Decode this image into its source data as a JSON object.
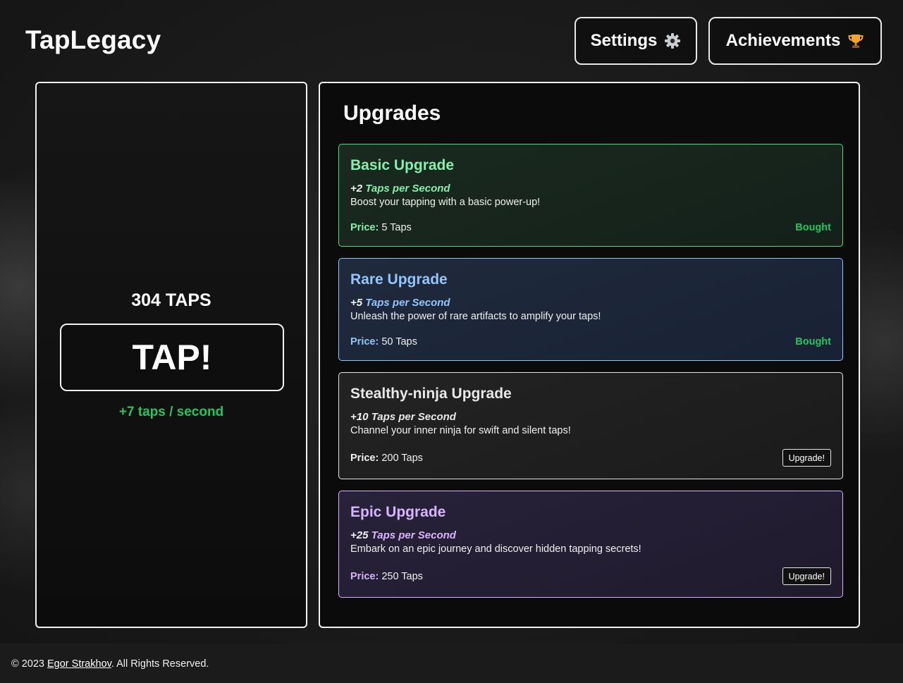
{
  "header": {
    "title": "TapLegacy",
    "settings_label": "Settings",
    "settings_icon": "gear-icon",
    "achievements_label": "Achievements",
    "achievements_icon": "trophy-icon"
  },
  "tapper": {
    "count_label": "304 TAPS",
    "button_label": "TAP!",
    "rate_label": "+7 taps / second"
  },
  "upgrades": {
    "heading": "Upgrades",
    "items": [
      {
        "title": "Basic Upgrade",
        "tps_amount": "+2",
        "tps_unit": "Taps per Second",
        "description": "Boost your tapping with a basic power-up!",
        "price_label": "Price:",
        "price_value": "5 Taps",
        "status": "Bought",
        "accent": "#86efac"
      },
      {
        "title": "Rare Upgrade",
        "tps_amount": "+5",
        "tps_unit": "Taps per Second",
        "description": "Unleash the power of rare artifacts to amplify your taps!",
        "price_label": "Price:",
        "price_value": "50 Taps",
        "status": "Bought",
        "accent": "#93c5fd"
      },
      {
        "title": "Stealthy-ninja Upgrade",
        "tps_amount": "+10",
        "tps_unit": "Taps per Second",
        "description": "Channel your inner ninja for swift and silent taps!",
        "price_label": "Price:",
        "price_value": "200 Taps",
        "status": "Upgrade!",
        "accent": "#e8e8e8"
      },
      {
        "title": "Epic Upgrade",
        "tps_amount": "+25",
        "tps_unit": "Taps per Second",
        "description": "Embark on an epic journey and discover hidden tapping secrets!",
        "price_label": "Price:",
        "price_value": "250 Taps",
        "status": "Upgrade!",
        "accent": "#d8b4fe"
      }
    ]
  },
  "footer": {
    "prefix": "© 2023 ",
    "author_link": "Egor Strakhov",
    "suffix": ". All Rights Reserved."
  },
  "colors": {
    "bought_green": "#22c55e",
    "rate_green": "#22c55e"
  }
}
